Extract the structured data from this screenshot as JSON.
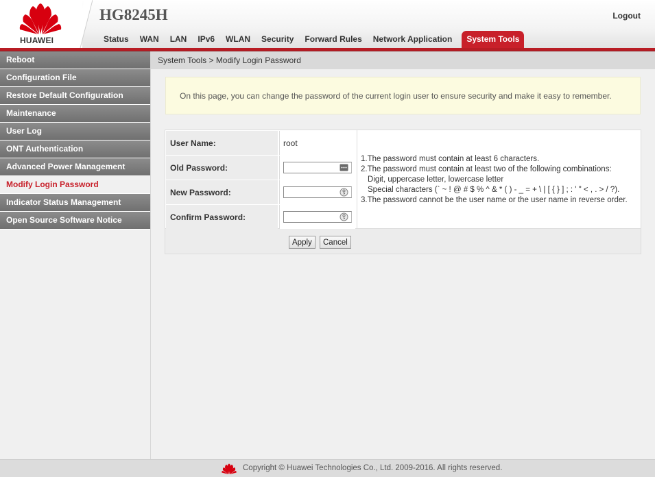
{
  "brand": {
    "name": "HUAWEI",
    "model": "HG8245H",
    "accent_color": "#c8202a"
  },
  "header": {
    "logout_label": "Logout",
    "tabs": [
      {
        "label": "Status"
      },
      {
        "label": "WAN"
      },
      {
        "label": "LAN"
      },
      {
        "label": "IPv6"
      },
      {
        "label": "WLAN"
      },
      {
        "label": "Security"
      },
      {
        "label": "Forward Rules"
      },
      {
        "label": "Network Application"
      },
      {
        "label": "System Tools",
        "active": true
      }
    ]
  },
  "sidebar": {
    "items": [
      {
        "label": "Reboot"
      },
      {
        "label": "Configuration File"
      },
      {
        "label": "Restore Default Configuration"
      },
      {
        "label": "Maintenance"
      },
      {
        "label": "User Log"
      },
      {
        "label": "ONT Authentication"
      },
      {
        "label": "Advanced Power Management"
      },
      {
        "label": "Modify Login Password",
        "active": true
      },
      {
        "label": "Indicator Status Management"
      },
      {
        "label": "Open Source Software Notice"
      }
    ]
  },
  "main": {
    "breadcrumb": "System Tools > Modify Login Password",
    "info_text": "On this page, you can change the password of the current login user to ensure security and make it easy to remember.",
    "form": {
      "username_label": "User Name:",
      "username_value": "root",
      "old_password_label": "Old Password:",
      "new_password_label": "New Password:",
      "confirm_password_label": "Confirm Password:"
    },
    "rules": {
      "line1": "1.The password must contain at least 6 characters.",
      "line2": "2.The password must contain at least two of the following combinations:",
      "line2a": "Digit, uppercase letter, lowercase letter",
      "line2b": "Special characters (` ~ ! @ # $ % ^ & * ( ) - _ = + \\ | [ { } ] ; : ' \" < , . > / ?).",
      "line3": "3.The password cannot be the user name or the user name in reverse order."
    },
    "buttons": {
      "apply_label": "Apply",
      "cancel_label": "Cancel"
    }
  },
  "footer": {
    "copyright": "Copyright © Huawei Technologies Co., Ltd. 2009-2016. All rights reserved."
  }
}
